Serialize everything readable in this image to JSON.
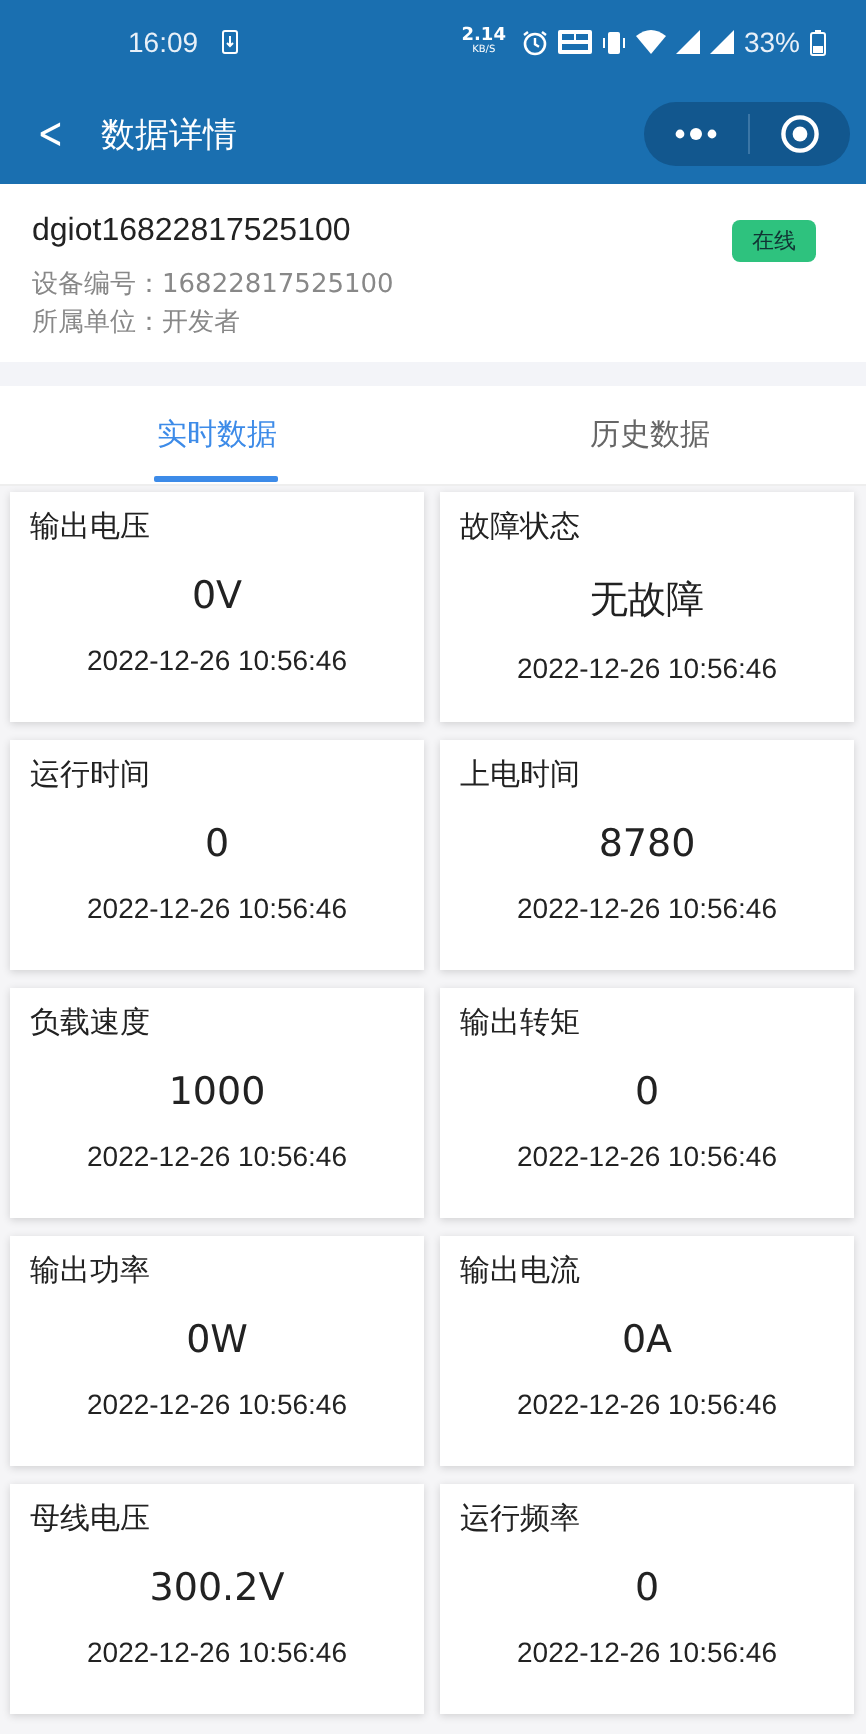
{
  "status_bar": {
    "time": "16:09",
    "speed_value": "2.14",
    "speed_unit": "KB/S",
    "battery": "33%"
  },
  "nav_bar": {
    "back": "<",
    "title": "数据详情"
  },
  "device": {
    "name": "dgiot16822817525100",
    "status": "在线",
    "online": true,
    "fields": [
      {
        "label": "设备编号：",
        "value": "16822817525100"
      },
      {
        "label": "所属单位：",
        "value": "开发者"
      }
    ]
  },
  "tabs": [
    {
      "label": "实时数据",
      "selected": true
    },
    {
      "label": "历史数据",
      "selected": false
    }
  ],
  "cards": [
    {
      "title": "输出电压",
      "value": "0V",
      "time": "2022-12-26 10:56:46"
    },
    {
      "title": "故障状态",
      "value": "无故障",
      "time": "2022-12-26 10:56:46"
    },
    {
      "title": "运行时间",
      "value": "0",
      "time": "2022-12-26 10:56:46"
    },
    {
      "title": "上电时间",
      "value": "8780",
      "time": "2022-12-26 10:56:46"
    },
    {
      "title": "负载速度",
      "value": "1000",
      "time": "2022-12-26 10:56:46"
    },
    {
      "title": "输出转矩",
      "value": "0",
      "time": "2022-12-26 10:56:46"
    },
    {
      "title": "输出功率",
      "value": "0W",
      "time": "2022-12-26 10:56:46"
    },
    {
      "title": "输出电流",
      "value": "0A",
      "time": "2022-12-26 10:56:46"
    },
    {
      "title": "母线电压",
      "value": "300.2V",
      "time": "2022-12-26 10:56:46"
    },
    {
      "title": "运行频率",
      "value": "0",
      "time": "2022-12-26 10:56:46"
    }
  ]
}
